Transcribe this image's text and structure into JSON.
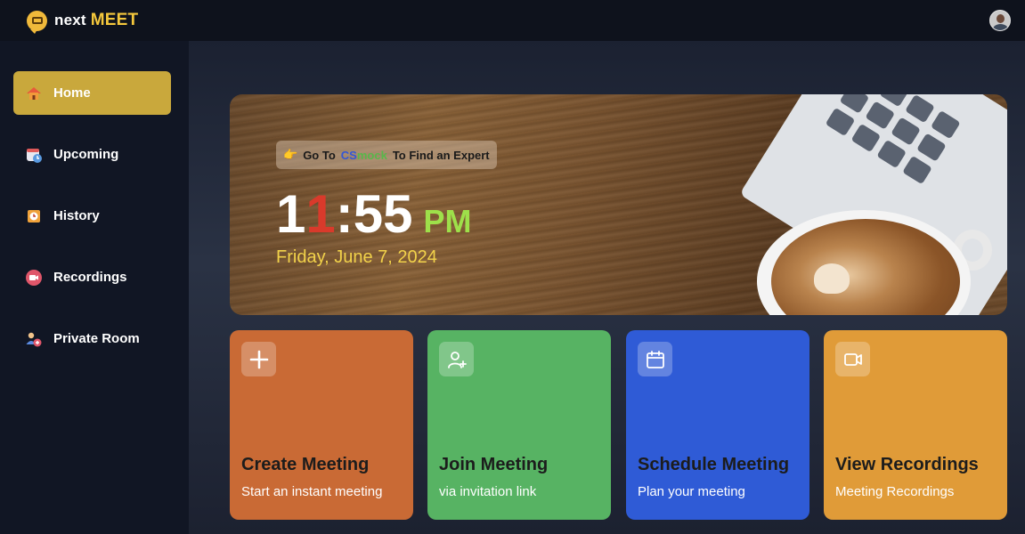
{
  "brand": {
    "word1": "next",
    "word2": "MEET"
  },
  "nav": [
    {
      "label": "Home",
      "icon": "home-icon",
      "active": true
    },
    {
      "label": "Upcoming",
      "icon": "calendar-clock-icon",
      "active": false
    },
    {
      "label": "History",
      "icon": "history-icon",
      "active": false
    },
    {
      "label": "Recordings",
      "icon": "video-icon",
      "active": false
    },
    {
      "label": "Private Room",
      "icon": "users-icon",
      "active": false
    }
  ],
  "hero": {
    "banner_prefix": "Go To",
    "banner_cs": "CS",
    "banner_mock": "mock",
    "banner_suffix": "To Find an Expert",
    "banner_emoji": "👉",
    "time_h1": "1",
    "time_h2": "1",
    "time_rest": ":55",
    "time_ampm": "PM",
    "date": "Friday, June 7, 2024"
  },
  "cards": [
    {
      "title": "Create Meeting",
      "subtitle": "Start an instant meeting",
      "icon": "plus-icon",
      "color": "#c96a35"
    },
    {
      "title": "Join Meeting",
      "subtitle": "via invitation link",
      "icon": "user-plus-icon",
      "color": "#57b363"
    },
    {
      "title": "Schedule Meeting",
      "subtitle": "Plan your meeting",
      "icon": "calendar-icon",
      "color": "#2f5bd6"
    },
    {
      "title": "View Recordings",
      "subtitle": "Meeting Recordings",
      "icon": "video-camera-icon",
      "color": "#e09b38"
    }
  ],
  "colors": {
    "accent": "#c9a83c",
    "brand_yellow": "#f5c83c",
    "time_ampm": "#9ee04a",
    "date": "#f2d24a"
  }
}
